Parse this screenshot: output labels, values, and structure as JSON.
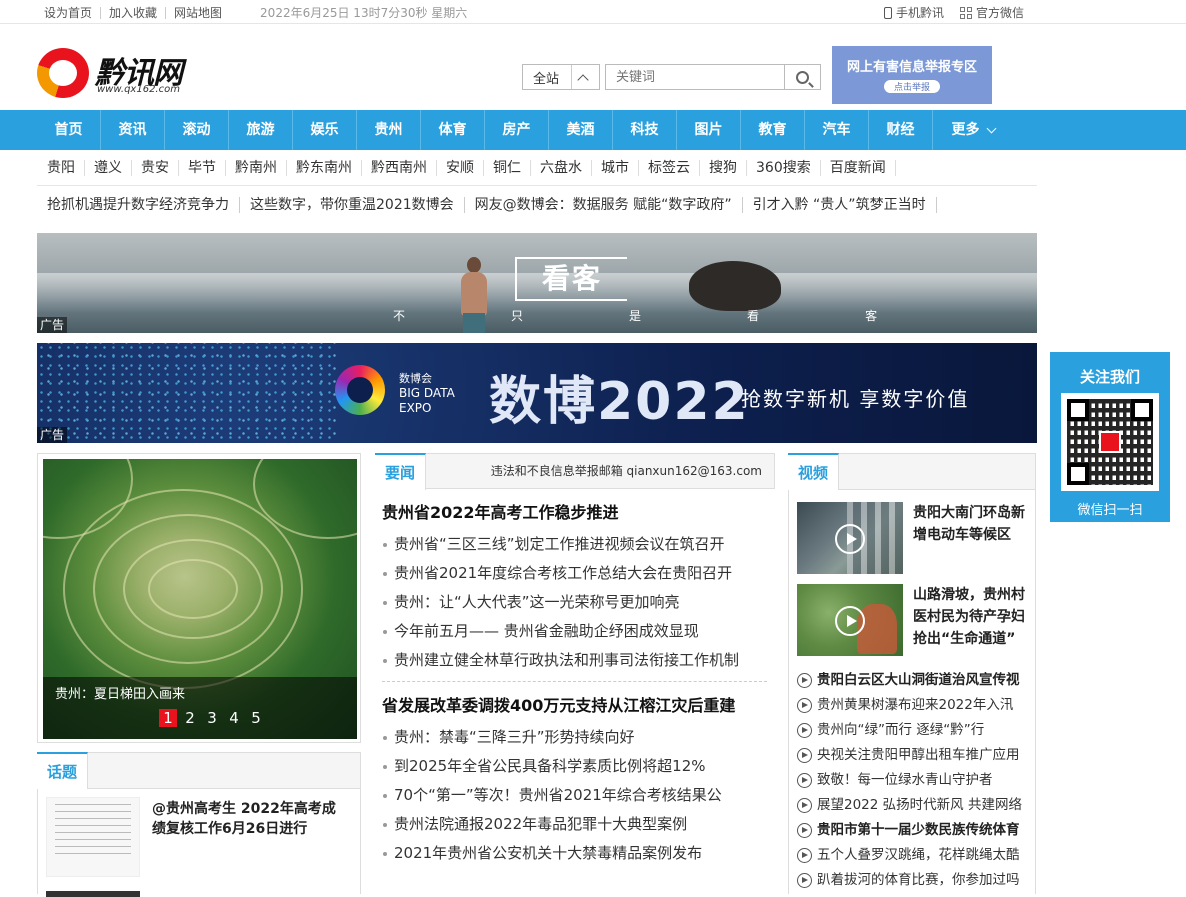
{
  "topbar": {
    "set_home": "设为首页",
    "bookmark": "加入收藏",
    "sitemap": "网站地图",
    "datetime": "2022年6月25日 13时7分30秒 星期六",
    "mobile": "手机黔讯",
    "wechat": "官方微信",
    "mobile_icon": "phone-icon",
    "wechat_icon": "qrcode-icon"
  },
  "header": {
    "logo_name": "黔讯网",
    "logo_url": "www.qx162.com",
    "search_scope": "全站",
    "search_placeholder": "关键词",
    "report_title": "网上有害信息举报专区",
    "report_button": "点击举报"
  },
  "nav": {
    "items": [
      "首页",
      "资讯",
      "滚动",
      "旅游",
      "娱乐",
      "贵州",
      "体育",
      "房产",
      "美酒",
      "科技",
      "图片",
      "教育",
      "汽车",
      "财经"
    ],
    "more": "更多",
    "color": "#2aa0de"
  },
  "regions": [
    "贵阳",
    "遵义",
    "贵安",
    "毕节",
    "黔南州",
    "黔东南州",
    "黔西南州",
    "安顺",
    "铜仁",
    "六盘水",
    "城市",
    "标签云",
    "搜狗",
    "360搜索",
    "百度新闻"
  ],
  "headlines": [
    "抢抓机遇提升数字经济竞争力",
    "这些数字，带你重温2021数博会",
    "网友@数博会：数据服务 赋能“数字政府”",
    "引才入黔 “贵人”筑梦正当时"
  ],
  "ads": {
    "ad_label": "广告",
    "ad1_logo": "看客",
    "ad1_slogan": [
      "不",
      "只",
      "是",
      "看",
      "客"
    ],
    "ad2_expo_cn": "数博会",
    "ad2_expo_en1": "BIG DATA",
    "ad2_expo_en2": "EXPO",
    "ad2_big": "数博2022",
    "ad2_tagline": "抢数字新机 享数字价值"
  },
  "follow": {
    "title": "关注我们",
    "subtitle": "微信扫一扫"
  },
  "slider": {
    "caption": "贵州：夏日梯田入画来",
    "pages": [
      "1",
      "2",
      "3",
      "4",
      "5"
    ],
    "active": 1
  },
  "topic": {
    "tab": "话题",
    "title": "@贵州高考生 2022年高考成绩复核工作6月26日进行"
  },
  "news": {
    "tab": "要闻",
    "report_mail": "违法和不良信息举报邮箱 qianxun162@163.com",
    "group1_title": "贵州省2022年高考工作稳步推进",
    "group1": [
      "贵州省“三区三线”划定工作推进视频会议在筑召开",
      "贵州省2021年度综合考核工作总结大会在贵阳召开",
      "贵州：让“人大代表”这一光荣称号更加响亮",
      "今年前五月—— 贵州省金融助企纾困成效显现",
      "贵州建立健全林草行政执法和刑事司法衔接工作机制"
    ],
    "group2_title": "省发展改革委调拨400万元支持从江榕江灾后重建",
    "group2": [
      "贵州：禁毒“三降三升”形势持续向好",
      "到2025年全省公民具备科学素质比例将超12%",
      "70个“第一”等次！贵州省2021年综合考核结果公",
      "贵州法院通报2022年毒品犯罪十大典型案例",
      "2021年贵州省公安机关十大禁毒精品案例发布"
    ]
  },
  "video": {
    "tab": "视频",
    "item1": "贵阳大南门环岛新增电动车等候区",
    "item2": "山路滑坡，贵州村医村民为待产孕妇抢出“生命通道”",
    "list": [
      {
        "text": "贵阳白云区大山洞街道治风宣传视",
        "bold": true
      },
      {
        "text": "贵州黄果树瀑布迎来2022年入汛",
        "bold": false
      },
      {
        "text": "贵州向“绿”而行 逐绿“黔”行",
        "bold": false
      },
      {
        "text": "央视关注贵阳甲醇出租车推广应用",
        "bold": false
      },
      {
        "text": "致敬！每一位绿水青山守护者",
        "bold": false
      },
      {
        "text": "展望2022 弘扬时代新风 共建网络",
        "bold": false
      },
      {
        "text": "贵阳市第十一届少数民族传统体育",
        "bold": true
      },
      {
        "text": "五个人叠罗汉跳绳，花样跳绳太酷",
        "bold": false
      },
      {
        "text": "趴着拔河的体育比赛，你参加过吗",
        "bold": false
      }
    ]
  }
}
